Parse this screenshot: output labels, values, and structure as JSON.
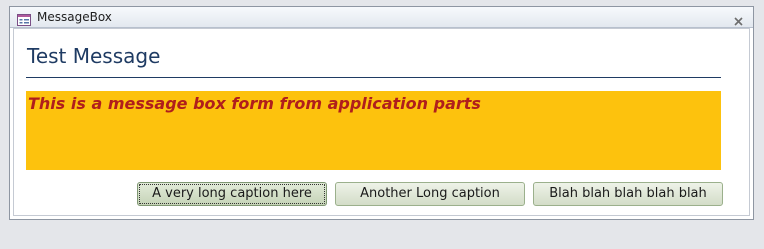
{
  "window": {
    "title": "MessageBox",
    "icons": {
      "app": "form-icon",
      "close": "close-icon"
    }
  },
  "form": {
    "heading": "Test Message",
    "message": "This is a message box form from application parts",
    "message_panel_color": "#fdc20d",
    "message_text_color": "#b01e1c",
    "heading_color": "#1f3b63"
  },
  "buttons": [
    {
      "label": "A very long caption here",
      "focused": true
    },
    {
      "label": "Another Long caption",
      "focused": false
    },
    {
      "label": "Blah blah blah blah blah",
      "focused": false
    }
  ]
}
